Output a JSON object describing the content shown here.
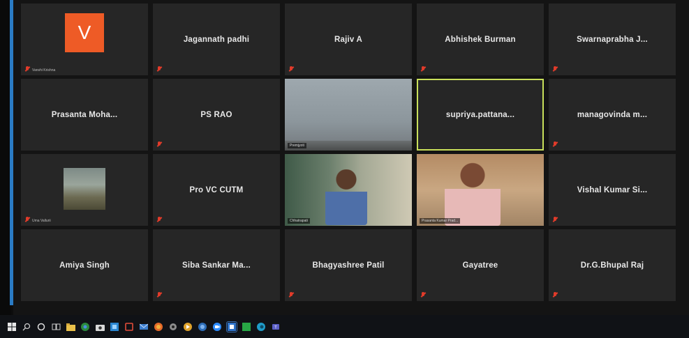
{
  "accent_color": "#2a7bc4",
  "active_speaker_color": "#c9e05a",
  "participants": [
    {
      "name": "Vanshi Krishna",
      "type": "avatar",
      "initial": "V"
    },
    {
      "name": "Jagannath padhi"
    },
    {
      "name": "Rajiv A"
    },
    {
      "name": "Abhishek Burman"
    },
    {
      "name": "Swarnaprabha J..."
    },
    {
      "name": "Prasanta Moha..."
    },
    {
      "name": "PS RAO"
    },
    {
      "name": "Premjyoti",
      "type": "video"
    },
    {
      "name": "supriya.pattana...",
      "active": true
    },
    {
      "name": "managovinda m..."
    },
    {
      "name": "Uma Vallurii",
      "type": "photo"
    },
    {
      "name": "Pro VC CUTM"
    },
    {
      "name": "Chhatrapati",
      "type": "video"
    },
    {
      "name": "Prasanta Kumar Prad...",
      "type": "video"
    },
    {
      "name": "Vishal Kumar Si..."
    },
    {
      "name": "Amiya Singh"
    },
    {
      "name": "Siba Sankar Ma..."
    },
    {
      "name": "Bhagyashree Patil"
    },
    {
      "name": "Gayatree"
    },
    {
      "name": "Dr.G.Bhupal Raj"
    }
  ],
  "taskbar": [
    {
      "icon": "windows-start-icon"
    },
    {
      "icon": "search-icon"
    },
    {
      "icon": "cortana-icon"
    },
    {
      "icon": "task-view-icon"
    },
    {
      "icon": "file-explorer-icon"
    },
    {
      "icon": "chrome-icon"
    },
    {
      "icon": "camera-icon"
    },
    {
      "icon": "store-icon"
    },
    {
      "icon": "office-icon"
    },
    {
      "icon": "mail-icon"
    },
    {
      "icon": "firefox-icon"
    },
    {
      "icon": "settings-icon"
    },
    {
      "icon": "media-icon"
    },
    {
      "icon": "browser-icon"
    },
    {
      "icon": "zoom-icon"
    },
    {
      "icon": "meeting-icon"
    },
    {
      "icon": "green-app-icon"
    },
    {
      "icon": "edge-icon"
    },
    {
      "icon": "teams-icon"
    }
  ]
}
